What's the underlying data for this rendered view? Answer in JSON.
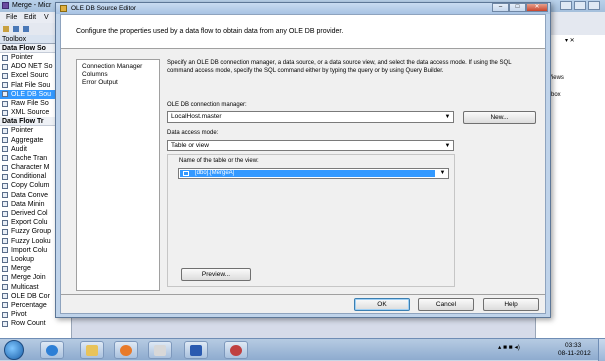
{
  "background_app": {
    "title": "Merge - Micr",
    "menu": [
      "File",
      "Edit",
      "V"
    ],
    "toolbox": {
      "header": "Toolbox",
      "sections": [
        {
          "label": "Data Flow So",
          "items": [
            "Pointer",
            "ADO NET So",
            "Excel Sourc",
            "Flat File Sou",
            "OLE DB Sou",
            "Raw File So",
            "XML Source"
          ]
        },
        {
          "label": "Data Flow Tr",
          "items": [
            "Pointer",
            "Aggregate",
            "Audit",
            "Cache Tran",
            "Character M",
            "Conditional",
            "Copy Colum",
            "Data Conve",
            "Data Minin",
            "Derived Col",
            "Export Colu",
            "Fuzzy Group",
            "Fuzzy Looku",
            "Import Colu",
            "Lookup",
            "Merge",
            "Merge Join",
            "Multicast",
            "OLE DB Cor",
            "Percentage",
            "Pivot",
            "Row Count"
          ]
        }
      ],
      "selected": "OLE DB Sou"
    },
    "right_panel": {
      "pin": "▾ ✕",
      "label1": "Views",
      "label2": "ltbox"
    }
  },
  "dialog": {
    "title": "OLE DB Source Editor",
    "description": "Configure the properties used by a data flow to obtain data from any OLE DB provider.",
    "nav_items": [
      "Connection Manager",
      "Columns",
      "Error Output"
    ],
    "content_description": "Specify an OLE DB connection manager, a data source, or a data source view, and select the data access mode. If using the SQL command access mode, specify the SQL command either by typing the query or by using Query Builder.",
    "connection_manager_label": "OLE DB connection manager:",
    "connection_manager_value": "LocalHost.master",
    "new_button": "New...",
    "data_access_mode_label": "Data access mode:",
    "data_access_mode_value": "Table or view",
    "table_label": "Name of the table or the view:",
    "table_value": "[dbo].[MergeA]",
    "preview_button": "Preview...",
    "ok_button": "OK",
    "cancel_button": "Cancel",
    "help_button": "Help",
    "window_buttons": {
      "minimize": "–",
      "maximize": "□",
      "close": "✕"
    }
  },
  "taskbar": {
    "time": "03:33",
    "date": "08-11-2012",
    "tray": "▴ ■ ■ ◂)",
    "apps": [
      "ie-icon",
      "explorer-icon",
      "media-player-icon",
      "tools-icon",
      "visual-studio-icon",
      "word-icon",
      "paint-icon"
    ]
  }
}
